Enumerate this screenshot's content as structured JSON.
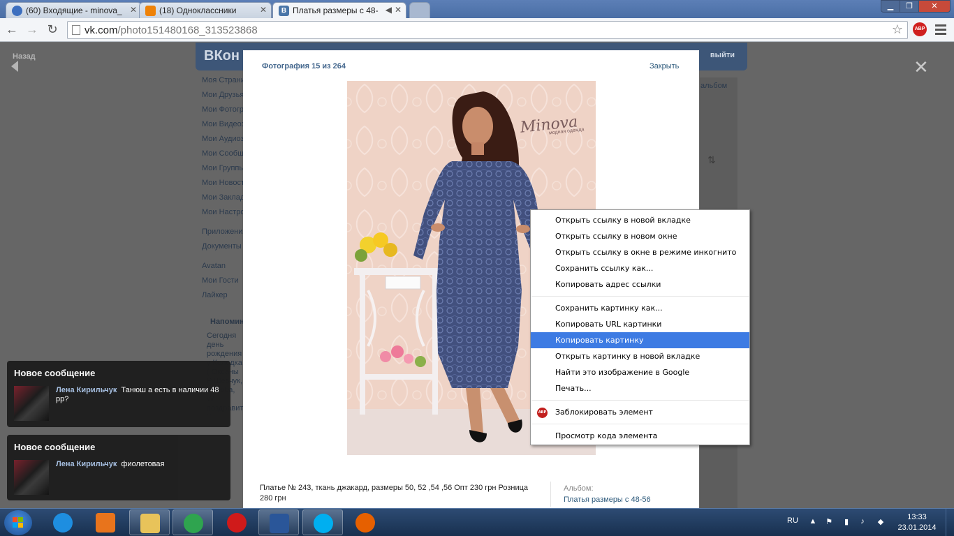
{
  "browser": {
    "tabs": [
      {
        "title": "(60) Входящие - minova_",
        "favicon_color": "#3d6fbf"
      },
      {
        "title": "(18) Одноклассники",
        "favicon_color": "#ee8208"
      },
      {
        "title": "Платья размеры с 48-",
        "favicon_color": "#4a76a8"
      }
    ],
    "url_host": "vk.com",
    "url_path": "/photo151480168_313523868",
    "abp_label": "ABP"
  },
  "vk_page": {
    "logo": "ВКон",
    "logout": "выйти",
    "back": "Назад",
    "menu": [
      "Моя Страница",
      "Мои Друзья",
      "Мои Фотографии",
      "Мои Видеозаписи",
      "Мои Аудиозаписи",
      "Мои Сообщения",
      "Мои Группы",
      "Мои Новости",
      "Мои Закладки",
      "Мои Настройки",
      "",
      "Приложения",
      "Документы",
      "",
      "Avatan",
      "Мои Гости",
      "Лайкер"
    ],
    "reminder_title": "Напоминания",
    "reminder_text": "Сегодня день рождения у Колодка ( Оксаны Р Шевчук, Т Люба, W поздравит. Крылова, Е. Мищенко",
    "album_tab": "альбом"
  },
  "viewer": {
    "counter": "Фотография 15 из 264",
    "close": "Закрыть",
    "watermark": "Minova",
    "watermark_sub": "модная одежда",
    "caption": "Платье № 243, ткань джакард, размеры 50, 52 ,54 ,56 Опт 230 грн Розница 280 грн",
    "album_label": "Альбом:",
    "album_name": "Платья размеры с 48-56"
  },
  "context_menu": {
    "groups": [
      [
        "Открыть ссылку в новой вкладке",
        "Открыть ссылку в новом окне",
        "Открыть ссылку в окне в режиме инкогнито",
        "Сохранить ссылку как...",
        "Копировать адрес ссылки"
      ],
      [
        "Сохранить картинку как...",
        "Копировать URL картинки",
        "Копировать картинку",
        "Открыть картинку в новой вкладке",
        "Найти это изображение в Google",
        "Печать..."
      ],
      [
        "Заблокировать элемент"
      ],
      [
        "Просмотр кода элемента"
      ]
    ],
    "highlighted": "Копировать картинку",
    "abp_badge": "ABP"
  },
  "notifications": [
    {
      "title": "Новое сообщение",
      "author": "Лена Кирильчук",
      "text": "Танюш а есть в наличии 48 рр?"
    },
    {
      "title": "Новое сообщение",
      "author": "Лена Кирильчук",
      "text": "фиолетовая"
    }
  ],
  "taskbar": {
    "language": "RU",
    "time": "13:33",
    "date": "23.01.2014",
    "apps": [
      {
        "name": "internet-explorer",
        "color": "#1e8ee0",
        "pinned": false
      },
      {
        "name": "media-player",
        "color": "#e8741c",
        "pinned": false
      },
      {
        "name": "file-explorer",
        "color": "#e8c35a",
        "pinned": true
      },
      {
        "name": "chrome",
        "color": "#2fa44f",
        "pinned": true
      },
      {
        "name": "opera",
        "color": "#d01a1a",
        "pinned": false
      },
      {
        "name": "word",
        "color": "#2a5699",
        "pinned": true
      },
      {
        "name": "skype",
        "color": "#00aff0",
        "pinned": true
      },
      {
        "name": "firefox",
        "color": "#e66000",
        "pinned": false
      }
    ]
  },
  "colors": {
    "vk_blue": "#45688e",
    "highlight": "#3d7be3",
    "link": "#2b587a"
  }
}
